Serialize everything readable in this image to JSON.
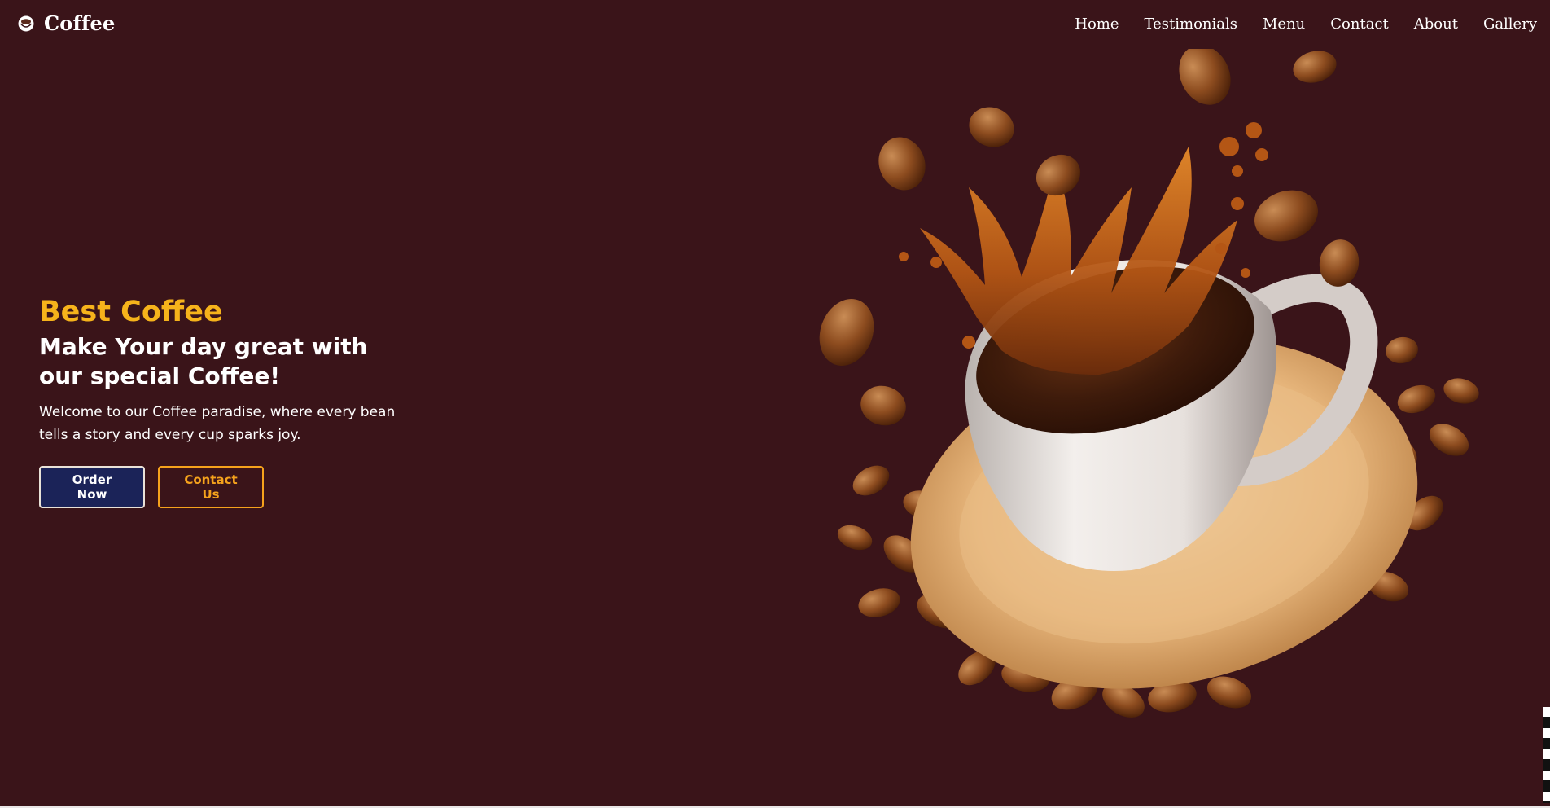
{
  "nav": {
    "brand": "Coffee",
    "brand_icon": "coffee-cup-icon",
    "links": [
      "Home",
      "Testimonials",
      "Menu",
      "Contact",
      "About",
      "Gallery"
    ]
  },
  "hero": {
    "kicker": "Best Coffee",
    "title": "Make Your day great with our special Coffee!",
    "description": "Welcome to our Coffee paradise, where every bean tells a story and every cup sparks joy.",
    "primary_button": "Order Now",
    "secondary_button": "Contact Us"
  },
  "colors": {
    "background": "#3a1419",
    "accent": "#f6b31b",
    "primary_button": "#1b2358",
    "outline_button": "#f5a21c"
  }
}
